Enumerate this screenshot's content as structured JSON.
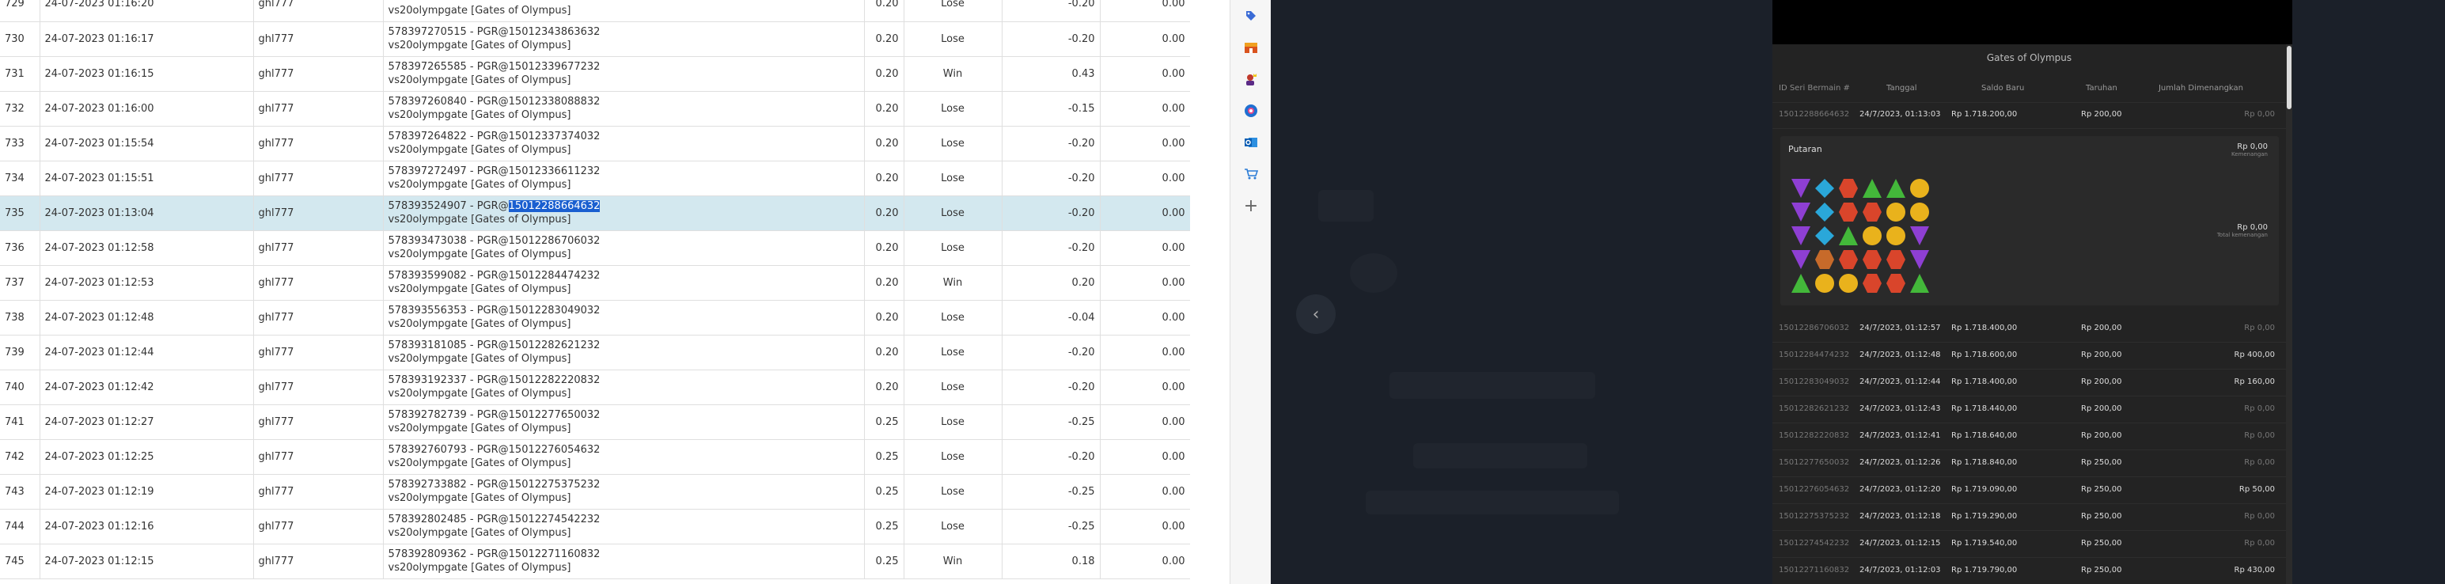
{
  "table": {
    "rows": [
      {
        "no": "729",
        "date": "24-07-2023 01:16:20",
        "user": "ghl777",
        "id": "",
        "game": "vs20olympgate [Gates of Olympus]",
        "bet": "0.20",
        "result": "Lose",
        "win": "-0.20",
        "jackpot": "0.00"
      },
      {
        "no": "730",
        "date": "24-07-2023 01:16:17",
        "user": "ghl777",
        "id": "578397270515 - PGR@15012343863632",
        "game": "vs20olympgate [Gates of Olympus]",
        "bet": "0.20",
        "result": "Lose",
        "win": "-0.20",
        "jackpot": "0.00"
      },
      {
        "no": "731",
        "date": "24-07-2023 01:16:15",
        "user": "ghl777",
        "id": "578397265585 - PGR@15012339677232",
        "game": "vs20olympgate [Gates of Olympus]",
        "bet": "0.20",
        "result": "Win",
        "win": "0.43",
        "jackpot": "0.00"
      },
      {
        "no": "732",
        "date": "24-07-2023 01:16:00",
        "user": "ghl777",
        "id": "578397260840 - PGR@15012338088832",
        "game": "vs20olympgate [Gates of Olympus]",
        "bet": "0.20",
        "result": "Lose",
        "win": "-0.15",
        "jackpot": "0.00"
      },
      {
        "no": "733",
        "date": "24-07-2023 01:15:54",
        "user": "ghl777",
        "id": "578397264822 - PGR@15012337374032",
        "game": "vs20olympgate [Gates of Olympus]",
        "bet": "0.20",
        "result": "Lose",
        "win": "-0.20",
        "jackpot": "0.00"
      },
      {
        "no": "734",
        "date": "24-07-2023 01:15:51",
        "user": "ghl777",
        "id": "578397272497 - PGR@15012336611232",
        "game": "vs20olympgate [Gates of Olympus]",
        "bet": "0.20",
        "result": "Lose",
        "win": "-0.20",
        "jackpot": "0.00"
      },
      {
        "no": "735",
        "date": "24-07-2023 01:13:04",
        "user": "ghl777",
        "id_prefix": "578393524907 - PGR@",
        "id_highlight": "15012288664632",
        "game": "vs20olympgate [Gates of Olympus]",
        "bet": "0.20",
        "result": "Lose",
        "win": "-0.20",
        "jackpot": "0.00",
        "selected": true
      },
      {
        "no": "736",
        "date": "24-07-2023 01:12:58",
        "user": "ghl777",
        "id": "578393473038 - PGR@15012286706032",
        "game": "vs20olympgate [Gates of Olympus]",
        "bet": "0.20",
        "result": "Lose",
        "win": "-0.20",
        "jackpot": "0.00"
      },
      {
        "no": "737",
        "date": "24-07-2023 01:12:53",
        "user": "ghl777",
        "id": "578393599082 - PGR@15012284474232",
        "game": "vs20olympgate [Gates of Olympus]",
        "bet": "0.20",
        "result": "Win",
        "win": "0.20",
        "jackpot": "0.00"
      },
      {
        "no": "738",
        "date": "24-07-2023 01:12:48",
        "user": "ghl777",
        "id": "578393556353 - PGR@15012283049032",
        "game": "vs20olympgate [Gates of Olympus]",
        "bet": "0.20",
        "result": "Lose",
        "win": "-0.04",
        "jackpot": "0.00"
      },
      {
        "no": "739",
        "date": "24-07-2023 01:12:44",
        "user": "ghl777",
        "id": "578393181085 - PGR@15012282621232",
        "game": "vs20olympgate [Gates of Olympus]",
        "bet": "0.20",
        "result": "Lose",
        "win": "-0.20",
        "jackpot": "0.00"
      },
      {
        "no": "740",
        "date": "24-07-2023 01:12:42",
        "user": "ghl777",
        "id": "578393192337 - PGR@15012282220832",
        "game": "vs20olympgate [Gates of Olympus]",
        "bet": "0.20",
        "result": "Lose",
        "win": "-0.20",
        "jackpot": "0.00"
      },
      {
        "no": "741",
        "date": "24-07-2023 01:12:27",
        "user": "ghl777",
        "id": "578392782739 - PGR@15012277650032",
        "game": "vs20olympgate [Gates of Olympus]",
        "bet": "0.25",
        "result": "Lose",
        "win": "-0.25",
        "jackpot": "0.00"
      },
      {
        "no": "742",
        "date": "24-07-2023 01:12:25",
        "user": "ghl777",
        "id": "578392760793 - PGR@15012276054632",
        "game": "vs20olympgate [Gates of Olympus]",
        "bet": "0.25",
        "result": "Lose",
        "win": "-0.20",
        "jackpot": "0.00"
      },
      {
        "no": "743",
        "date": "24-07-2023 01:12:19",
        "user": "ghl777",
        "id": "578392733882 - PGR@15012275375232",
        "game": "vs20olympgate [Gates of Olympus]",
        "bet": "0.25",
        "result": "Lose",
        "win": "-0.25",
        "jackpot": "0.00"
      },
      {
        "no": "744",
        "date": "24-07-2023 01:12:16",
        "user": "ghl777",
        "id": "578392802485 - PGR@15012274542232",
        "game": "vs20olympgate [Gates of Olympus]",
        "bet": "0.25",
        "result": "Lose",
        "win": "-0.25",
        "jackpot": "0.00"
      },
      {
        "no": "745",
        "date": "24-07-2023 01:12:15",
        "user": "ghl777",
        "id": "578392809362 - PGR@15012271160832",
        "game": "vs20olympgate [Gates of Olympus]",
        "bet": "0.25",
        "result": "Win",
        "win": "0.18",
        "jackpot": "0.00"
      }
    ]
  },
  "sidebar": {
    "icons": [
      "tag-icon",
      "shop-icon",
      "user-crown-icon",
      "globe-icon",
      "outlook-icon",
      "cart-icon",
      "add-icon"
    ],
    "add_label": "+"
  },
  "game": {
    "back_glyph": "‹",
    "history": {
      "title": "Gates of Olympus",
      "headers": {
        "id": "ID Seri Bermain #",
        "date": "Tanggal",
        "balance": "Saldo Baru",
        "bet": "Taruhan",
        "win": "Jumlah Dimenangkan"
      },
      "first_row": {
        "id": "15012288664632",
        "date": "24/7/2023, 01:13:03",
        "balance": "Rp 1.718.200,00",
        "bet": "Rp 200,00",
        "win": "Rp 0,00"
      },
      "spin": {
        "label": "Putaran",
        "amount1": "Rp 0,00",
        "sub1": "Kemenangan",
        "amount2": "Rp 0,00",
        "sub2": "Total kemenangan"
      },
      "rows": [
        {
          "id": "15012286706032",
          "date": "24/7/2023, 01:12:57",
          "balance": "Rp 1.718.400,00",
          "bet": "Rp 200,00",
          "win": "Rp 0,00"
        },
        {
          "id": "15012284474232",
          "date": "24/7/2023, 01:12:48",
          "balance": "Rp 1.718.600,00",
          "bet": "Rp 200,00",
          "win": "Rp 400,00"
        },
        {
          "id": "15012283049032",
          "date": "24/7/2023, 01:12:44",
          "balance": "Rp 1.718.400,00",
          "bet": "Rp 200,00",
          "win": "Rp 160,00"
        },
        {
          "id": "15012282621232",
          "date": "24/7/2023, 01:12:43",
          "balance": "Rp 1.718.440,00",
          "bet": "Rp 200,00",
          "win": "Rp 0,00"
        },
        {
          "id": "15012282220832",
          "date": "24/7/2023, 01:12:41",
          "balance": "Rp 1.718.640,00",
          "bet": "Rp 200,00",
          "win": "Rp 0,00"
        },
        {
          "id": "15012277650032",
          "date": "24/7/2023, 01:12:26",
          "balance": "Rp 1.718.840,00",
          "bet": "Rp 250,00",
          "win": "Rp 0,00"
        },
        {
          "id": "15012276054632",
          "date": "24/7/2023, 01:12:20",
          "balance": "Rp 1.719.090,00",
          "bet": "Rp 250,00",
          "win": "Rp 50,00"
        },
        {
          "id": "15012275375232",
          "date": "24/7/2023, 01:12:18",
          "balance": "Rp 1.719.290,00",
          "bet": "Rp 250,00",
          "win": "Rp 0,00"
        },
        {
          "id": "15012274542232",
          "date": "24/7/2023, 01:12:15",
          "balance": "Rp 1.719.540,00",
          "bet": "Rp 250,00",
          "win": "Rp 0,00"
        },
        {
          "id": "15012271160832",
          "date": "24/7/2023, 01:12:03",
          "balance": "Rp 1.719.790,00",
          "bet": "Rp 250,00",
          "win": "Rp 430,00"
        }
      ]
    },
    "reels": [
      [
        "purple-gem",
        "blue-gem",
        "red-gem",
        "green-gem",
        "green-gem",
        "yellow-gem"
      ],
      [
        "purple-gem",
        "blue-gem",
        "red-gem",
        "red-gem",
        "yellow-gem",
        "yellow-gem"
      ],
      [
        "purple-gem",
        "blue-gem",
        "green-gem",
        "yellow-gem",
        "yellow-gem",
        "purple-gem"
      ],
      [
        "purple-gem",
        "crown-gem",
        "red-gem",
        "red-gem",
        "red-gem",
        "purple-gem"
      ],
      [
        "green-gem",
        "yellow-gem",
        "yellow-gem",
        "red-gem",
        "red-gem",
        "green-gem"
      ]
    ],
    "colors": {
      "purple-gem": "#8e3fd3",
      "blue-gem": "#2aa7d9",
      "red-gem": "#d9452b",
      "green-gem": "#43b83a",
      "yellow-gem": "#e9b21c",
      "crown-gem": "#c76a2a"
    }
  }
}
